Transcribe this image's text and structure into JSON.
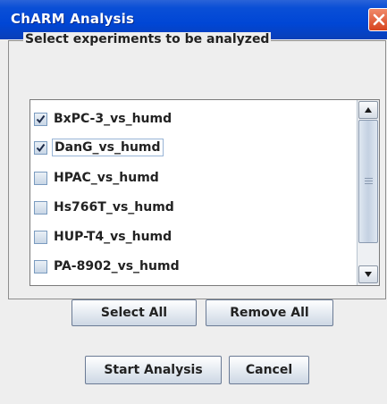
{
  "window": {
    "title": "ChARM Analysis"
  },
  "group": {
    "title": "Select experiments to be analyzed"
  },
  "experiments": [
    {
      "label": "BxPC-3_vs_humd",
      "checked": true
    },
    {
      "label": "DanG_vs_humd",
      "checked": true
    },
    {
      "label": "HPAC_vs_humd",
      "checked": false
    },
    {
      "label": "Hs766T_vs_humd",
      "checked": false
    },
    {
      "label": "HUP-T4_vs_humd",
      "checked": false
    },
    {
      "label": "PA-8902_vs_humd",
      "checked": false
    }
  ],
  "buttons": {
    "select_all": "Select All",
    "remove_all": "Remove All",
    "start_analysis": "Start Analysis",
    "cancel": "Cancel"
  },
  "icons": {
    "close": "close-icon",
    "check": "check-icon",
    "scroll_up": "arrow-up-icon",
    "scroll_down": "arrow-down-icon"
  },
  "colors": {
    "titlebar": "#0046d5",
    "close_button": "#d6431e",
    "background": "#eeeeee"
  }
}
